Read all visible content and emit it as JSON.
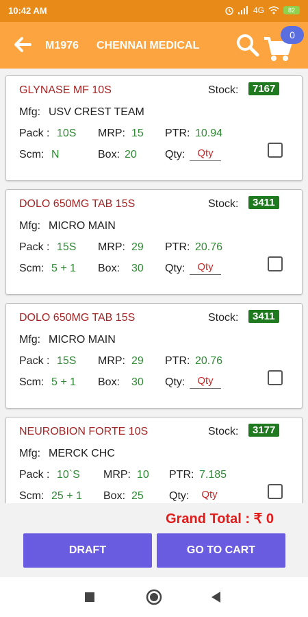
{
  "status_bar": {
    "time": "10:42 AM",
    "network": "4G",
    "battery": "82"
  },
  "header": {
    "code": "M1976",
    "shop_name": "CHENNAI MEDICAL",
    "cart_count": "0"
  },
  "labels": {
    "stock": "Stock:",
    "mfg": "Mfg:",
    "pack": "Pack :",
    "mrp": "MRP:",
    "ptr": "PTR:",
    "scm": "Scm:",
    "box": "Box:",
    "qty": "Qty:",
    "qty_placeholder": "Qty"
  },
  "products": [
    {
      "name": "GLYNASE MF 10S",
      "stock": "7167",
      "mfg": "USV CREST TEAM",
      "pack": "10S",
      "mrp": "15",
      "ptr": "10.94",
      "scm": "N",
      "box": "20"
    },
    {
      "name": "DOLO 650MG TAB 15S",
      "stock": "3411",
      "mfg": "MICRO MAIN",
      "pack": "15S",
      "mrp": "29",
      "ptr": "20.76",
      "scm": "5 + 1",
      "box": "30"
    },
    {
      "name": "DOLO 650MG TAB 15S",
      "stock": "3411",
      "mfg": "MICRO MAIN",
      "pack": "15S",
      "mrp": "29",
      "ptr": "20.76",
      "scm": "5 + 1",
      "box": "30"
    },
    {
      "name": "NEUROBION FORTE 10S",
      "stock": "3177",
      "mfg": "MERCK CHC",
      "pack": "10`S",
      "mrp": "10",
      "ptr": "7.185",
      "scm": "25 + 1",
      "box": "25"
    }
  ],
  "footer": {
    "grand_total": "Grand Total : ₹ 0",
    "draft_label": "DRAFT",
    "cart_label": "GO TO CART"
  },
  "colors": {
    "appbar": "#fca43f",
    "statusbar": "#e88a17",
    "product_name": "#a52424",
    "value_green": "#2f8a34",
    "stock_badge": "#1f7a1f",
    "button": "#6a5ce0",
    "grand_total": "#e21b1b"
  }
}
